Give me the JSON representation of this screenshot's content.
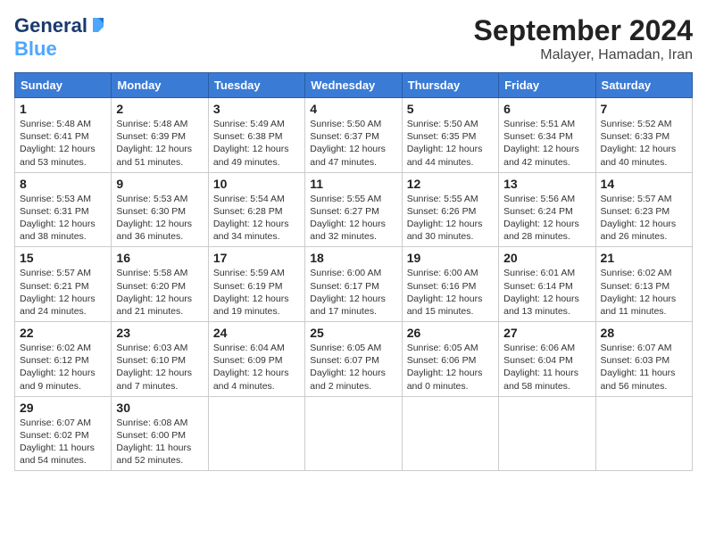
{
  "logo": {
    "line1": "General",
    "line2": "Blue"
  },
  "header": {
    "month": "September 2024",
    "location": "Malayer, Hamadan, Iran"
  },
  "weekdays": [
    "Sunday",
    "Monday",
    "Tuesday",
    "Wednesday",
    "Thursday",
    "Friday",
    "Saturday"
  ],
  "weeks": [
    [
      {
        "day": "1",
        "sunrise": "5:48 AM",
        "sunset": "6:41 PM",
        "daylight": "12 hours and 53 minutes."
      },
      {
        "day": "2",
        "sunrise": "5:48 AM",
        "sunset": "6:39 PM",
        "daylight": "12 hours and 51 minutes."
      },
      {
        "day": "3",
        "sunrise": "5:49 AM",
        "sunset": "6:38 PM",
        "daylight": "12 hours and 49 minutes."
      },
      {
        "day": "4",
        "sunrise": "5:50 AM",
        "sunset": "6:37 PM",
        "daylight": "12 hours and 47 minutes."
      },
      {
        "day": "5",
        "sunrise": "5:50 AM",
        "sunset": "6:35 PM",
        "daylight": "12 hours and 44 minutes."
      },
      {
        "day": "6",
        "sunrise": "5:51 AM",
        "sunset": "6:34 PM",
        "daylight": "12 hours and 42 minutes."
      },
      {
        "day": "7",
        "sunrise": "5:52 AM",
        "sunset": "6:33 PM",
        "daylight": "12 hours and 40 minutes."
      }
    ],
    [
      {
        "day": "8",
        "sunrise": "5:53 AM",
        "sunset": "6:31 PM",
        "daylight": "12 hours and 38 minutes."
      },
      {
        "day": "9",
        "sunrise": "5:53 AM",
        "sunset": "6:30 PM",
        "daylight": "12 hours and 36 minutes."
      },
      {
        "day": "10",
        "sunrise": "5:54 AM",
        "sunset": "6:28 PM",
        "daylight": "12 hours and 34 minutes."
      },
      {
        "day": "11",
        "sunrise": "5:55 AM",
        "sunset": "6:27 PM",
        "daylight": "12 hours and 32 minutes."
      },
      {
        "day": "12",
        "sunrise": "5:55 AM",
        "sunset": "6:26 PM",
        "daylight": "12 hours and 30 minutes."
      },
      {
        "day": "13",
        "sunrise": "5:56 AM",
        "sunset": "6:24 PM",
        "daylight": "12 hours and 28 minutes."
      },
      {
        "day": "14",
        "sunrise": "5:57 AM",
        "sunset": "6:23 PM",
        "daylight": "12 hours and 26 minutes."
      }
    ],
    [
      {
        "day": "15",
        "sunrise": "5:57 AM",
        "sunset": "6:21 PM",
        "daylight": "12 hours and 24 minutes."
      },
      {
        "day": "16",
        "sunrise": "5:58 AM",
        "sunset": "6:20 PM",
        "daylight": "12 hours and 21 minutes."
      },
      {
        "day": "17",
        "sunrise": "5:59 AM",
        "sunset": "6:19 PM",
        "daylight": "12 hours and 19 minutes."
      },
      {
        "day": "18",
        "sunrise": "6:00 AM",
        "sunset": "6:17 PM",
        "daylight": "12 hours and 17 minutes."
      },
      {
        "day": "19",
        "sunrise": "6:00 AM",
        "sunset": "6:16 PM",
        "daylight": "12 hours and 15 minutes."
      },
      {
        "day": "20",
        "sunrise": "6:01 AM",
        "sunset": "6:14 PM",
        "daylight": "12 hours and 13 minutes."
      },
      {
        "day": "21",
        "sunrise": "6:02 AM",
        "sunset": "6:13 PM",
        "daylight": "12 hours and 11 minutes."
      }
    ],
    [
      {
        "day": "22",
        "sunrise": "6:02 AM",
        "sunset": "6:12 PM",
        "daylight": "12 hours and 9 minutes."
      },
      {
        "day": "23",
        "sunrise": "6:03 AM",
        "sunset": "6:10 PM",
        "daylight": "12 hours and 7 minutes."
      },
      {
        "day": "24",
        "sunrise": "6:04 AM",
        "sunset": "6:09 PM",
        "daylight": "12 hours and 4 minutes."
      },
      {
        "day": "25",
        "sunrise": "6:05 AM",
        "sunset": "6:07 PM",
        "daylight": "12 hours and 2 minutes."
      },
      {
        "day": "26",
        "sunrise": "6:05 AM",
        "sunset": "6:06 PM",
        "daylight": "12 hours and 0 minutes."
      },
      {
        "day": "27",
        "sunrise": "6:06 AM",
        "sunset": "6:04 PM",
        "daylight": "11 hours and 58 minutes."
      },
      {
        "day": "28",
        "sunrise": "6:07 AM",
        "sunset": "6:03 PM",
        "daylight": "11 hours and 56 minutes."
      }
    ],
    [
      {
        "day": "29",
        "sunrise": "6:07 AM",
        "sunset": "6:02 PM",
        "daylight": "11 hours and 54 minutes."
      },
      {
        "day": "30",
        "sunrise": "6:08 AM",
        "sunset": "6:00 PM",
        "daylight": "11 hours and 52 minutes."
      },
      null,
      null,
      null,
      null,
      null
    ]
  ],
  "labels": {
    "sunrise": "Sunrise:",
    "sunset": "Sunset:",
    "daylight": "Daylight:"
  }
}
